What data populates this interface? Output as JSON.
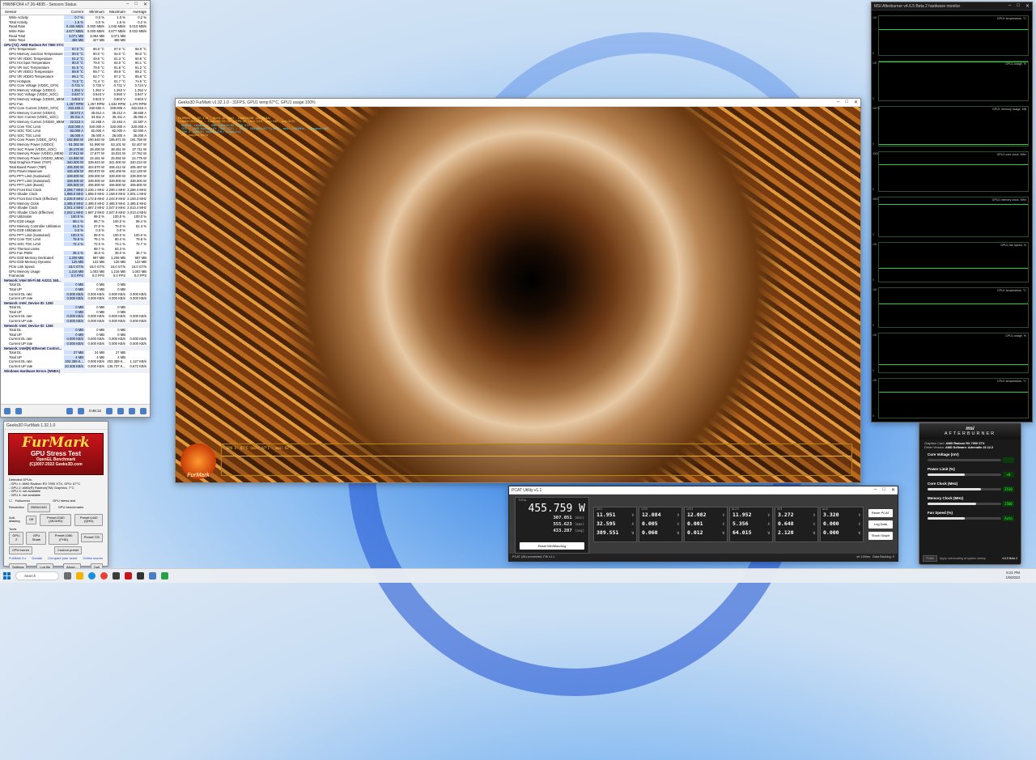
{
  "hwinfo": {
    "title": "HWiNFO64 v7.26-4835 - Sensors Status",
    "columns": [
      "Sensor",
      "Current",
      "Minimum",
      "Maximum",
      "Average"
    ],
    "rows": [
      {
        "n": "Write Activity",
        "v": [
          "0.7 %",
          "0.0 %",
          "1.0 %",
          "0.2 %"
        ]
      },
      {
        "n": "Total Activity",
        "v": [
          "1.5 %",
          "0.0 %",
          "1.6 %",
          "0.2 %"
        ]
      },
      {
        "n": "Read Rate",
        "v": [
          "0.155 MB/s",
          "0.000 MB/s",
          "1.040 MB/s",
          "0.010 MB/s"
        ]
      },
      {
        "n": "Write Rate",
        "v": [
          "4.677 MB/s",
          "0.000 MB/s",
          "4.677 MB/s",
          "0.022 MB/s"
        ]
      },
      {
        "n": "Read Total",
        "v": [
          "3,071 MB",
          "3,064 MB",
          "3,071 MB",
          ""
        ]
      },
      {
        "n": "Write Total",
        "v": [
          "488 MB",
          "427 MB",
          "488 MB",
          ""
        ]
      },
      {
        "n": "GPU [#2]: AMD Radeon RX 7900 XTX:",
        "g": true
      },
      {
        "n": "GPU Temperature",
        "v": [
          "67.0 °C",
          "66.0 °C",
          "67.0 °C",
          "66.9 °C"
        ]
      },
      {
        "n": "GPU Memory Junction Temperature",
        "v": [
          "90.0 °C",
          "90.0 °C",
          "92.0 °C",
          "90.0 °C"
        ]
      },
      {
        "n": "GPU VR VDDC Temperature",
        "v": [
          "51.2 °C",
          "49.6 °C",
          "51.3 °C",
          "50.6 °C"
        ]
      },
      {
        "n": "GPU Hot Spot Temperature",
        "v": [
          "80.0 °C",
          "79.0 °C",
          "82.0 °C",
          "80.1 °C"
        ]
      },
      {
        "n": "GPU VR SoC Temperature",
        "v": [
          "81.5 °C",
          "79.0 °C",
          "81.8 °C",
          "81.2 °C"
        ]
      },
      {
        "n": "GPU VR VDDCI Temperature",
        "v": [
          "89.9 °C",
          "89.7 °C",
          "89.9 °C",
          "89.2 °C"
        ]
      },
      {
        "n": "GPU VR VDDIO Temperature",
        "v": [
          "86.1 °C",
          "82.7 °C",
          "87.2 °C",
          "85.8 °C"
        ]
      },
      {
        "n": "GPU Hotspots",
        "v": [
          "74.0 °C",
          "71.4 °C",
          "81.7 °C",
          "74.6 °C"
        ]
      },
      {
        "n": "GPU Core Voltage (VDDC_GFX)",
        "v": [
          "0.731 V",
          "0.730 V",
          "0.731 V",
          "0.724 V"
        ]
      },
      {
        "n": "GPU Memory Voltage (VDDCI)",
        "v": [
          "1.352 V",
          "1.352 V",
          "1.353 V",
          "1.352 V"
        ]
      },
      {
        "n": "GPU SoC Voltage (VDDC_SOC)",
        "v": [
          "0.947 V",
          "0.943 V",
          "0.950 V",
          "0.947 V"
        ]
      },
      {
        "n": "GPU Memory Voltage (VDDIO_MEM)",
        "v": [
          "0.803 V",
          "0.803 V",
          "0.803 V",
          "0.803 V"
        ]
      },
      {
        "n": "GPU Fan",
        "v": [
          "1,457 RPM",
          "1,457 RPM",
          "1,534 RPM",
          "1,470 RPM"
        ]
      },
      {
        "n": "GPU Core Current (VDDC_GFX)",
        "v": [
          "263.460 A",
          "260.582 A",
          "269.806 A",
          "262.815 A"
        ]
      },
      {
        "n": "GPU Memory Current (VDDCI)",
        "v": [
          "38.574 A",
          "36.912 A",
          "39.212 A",
          "38.566 A"
        ]
      },
      {
        "n": "GPU SoC Current (VDDC_SOC)",
        "v": [
          "35.011 A",
          "34.811 A",
          "35.411 A",
          "35.092 A"
        ]
      },
      {
        "n": "GPU Memory Current (VDDIO_MEM)",
        "v": [
          "22.513 A",
          "22.268 A",
          "22.464 A",
          "22.387 A"
        ]
      },
      {
        "n": "GPU Core TDC Limit",
        "v": [
          "320.000 A",
          "320.000 A",
          "320.000 A",
          "320.000 A"
        ]
      },
      {
        "n": "GPU SOC TDC Limit",
        "v": [
          "82.000 A",
          "82.000 A",
          "82.000 A",
          "82.000 A"
        ]
      },
      {
        "n": "GPU SOC TDC Limit",
        "v": [
          "36.000 A",
          "36.000 A",
          "36.000 A",
          "36.000 A"
        ]
      },
      {
        "n": "GPU Core Power (VDDC_GFX)",
        "v": [
          "192.860 W",
          "190.540 W",
          "196.871 W",
          "191.759 W"
        ]
      },
      {
        "n": "GPU Memory Power (VDDCI)",
        "v": [
          "51.362 W",
          "51.990 W",
          "53.101 W",
          "52.407 W"
        ]
      },
      {
        "n": "GPU SoC Power (VDDC_SOC)",
        "v": [
          "36.478 W",
          "38.490 W",
          "38.451 W",
          "37.711 W"
        ]
      },
      {
        "n": "GPU Memory Power (VDDCI_MEM)",
        "v": [
          "17.912 W",
          "17.677 W",
          "18.022 W",
          "17.762 W"
        ]
      },
      {
        "n": "GPU Memory Power (VDDIO_MEM)",
        "v": [
          "24.990 W",
          "24.461 W",
          "25.092 W",
          "24.779 W"
        ]
      },
      {
        "n": "Total Graphics Power (TGP)",
        "v": [
          "340.000 W",
          "339.923 W",
          "341.000 W",
          "340.224 W"
        ]
      },
      {
        "n": "Total Board Power (TBP)",
        "v": [
          "406.090 W",
          "404.870 W",
          "406.412 W",
          "405.487 W"
        ]
      },
      {
        "n": "GPU Power Maximum",
        "v": [
          "426.408 W",
          "400.870 W",
          "426.408 W",
          "412.128 W"
        ]
      },
      {
        "n": "GPU PPT Limit (Sustained)",
        "v": [
          "339.000 W",
          "339.000 W",
          "339.000 W",
          "339.000 W"
        ]
      },
      {
        "n": "GPU PPT Limit (Sustained)",
        "v": [
          "339.000 W",
          "339.000 W",
          "339.000 W",
          "339.000 W"
        ]
      },
      {
        "n": "GPU PPT Limit (Boost)",
        "v": [
          "406.800 W",
          "406.800 W",
          "406.800 W",
          "406.800 W"
        ]
      },
      {
        "n": "GPU Front End Clock",
        "v": [
          "2,285.7 MHz",
          "2,226.1 MHz",
          "2,290.1 MHz",
          "2,256.4 MHz"
        ]
      },
      {
        "n": "GPU Shader Clock",
        "v": [
          "1,866.0 MHz",
          "1,866.0 MHz",
          "2,158.0 MHz",
          "2,001.1 MHz"
        ]
      },
      {
        "n": "GPU Front End Clock (Effective)",
        "v": [
          "2,226.0 MHz",
          "2,172.8 MHz",
          "2,244.9 MHz",
          "2,193.3 MHz"
        ]
      },
      {
        "n": "GPU Memory Clock",
        "v": [
          "2,485.0 MHz",
          "2,485.0 MHz",
          "2,485.0 MHz",
          "2,485.0 MHz"
        ]
      },
      {
        "n": "GPU Shader Clock",
        "v": [
          "2,041.4 MHz",
          "1,667.3 MHz",
          "2,047.0 MHz",
          "2,013.4 MHz"
        ]
      },
      {
        "n": "GPU Shader Clock (Effective)",
        "v": [
          "2,042.1 MHz",
          "1,667.3 MHz",
          "2,047.0 MHz",
          "2,013.4 MHz"
        ]
      },
      {
        "n": "GPU Utilization",
        "v": [
          "100.0 %",
          "99.0 %",
          "100.0 %",
          "100.0 %"
        ]
      },
      {
        "n": "GPU D3D Usage",
        "v": [
          "99.1 %",
          "98.7 %",
          "100.0 %",
          "99.4 %"
        ]
      },
      {
        "n": "GPU Memory Controller Utilization",
        "v": [
          "61.0 %",
          "27.0 %",
          "79.0 %",
          "61.3 %"
        ]
      },
      {
        "n": "GPU D3D Utilizations",
        "v": [
          "0.0 %",
          "0.0 %",
          "0.0 %",
          ""
        ]
      },
      {
        "n": "GPU PPT Limit (Sustained)",
        "v": [
          "100.0 %",
          "99.0 %",
          "100.0 %",
          "100.0 %"
        ]
      },
      {
        "n": "GPU Core TDC Limit",
        "v": [
          "79.9 %",
          "79.1 %",
          "80.4 %",
          "79.8 %"
        ]
      },
      {
        "n": "GPU SOC TDC Limit",
        "v": [
          "72.4 %",
          "72.0 %",
          "73.1 %",
          "72.7 %"
        ]
      },
      {
        "n": "GPU Thermal Limits",
        "v": [
          "",
          "98.7 %",
          "83.3 %",
          ""
        ]
      },
      {
        "n": "GPU Fan PWM",
        "v": [
          "36.4 %",
          "36.0 %",
          "38.0 %",
          "36.7 %"
        ]
      },
      {
        "n": "GPU D3D Memory Dedicated",
        "v": [
          "1,208 MB",
          "997 MB",
          "1,208 MB",
          "997 MB"
        ]
      },
      {
        "n": "GPU D3D Memory Dynamic",
        "v": [
          "125 MB",
          "122 MB",
          "125 MB",
          "122 MB"
        ]
      },
      {
        "n": "PCIe Link Speed",
        "v": [
          "16.0 GT/s",
          "16.0 GT/s",
          "16.0 GT/s",
          "16.0 GT/s"
        ]
      },
      {
        "n": "GPU Memory Usage",
        "v": [
          "1,216 MB",
          "1,003 MB",
          "1,216 MB",
          "1,003 MB"
        ]
      },
      {
        "n": "Framerate",
        "v": [
          "0.0 FPS",
          "0.0 FPS",
          "0.0 FPS",
          "0.0 FPS"
        ]
      },
      {
        "n": "Network: Intel Wi-Fi 6E AX211 160...",
        "g": true
      },
      {
        "n": "Total DL",
        "v": [
          "0 MB",
          "0 MB",
          "0 MB",
          ""
        ]
      },
      {
        "n": "Total UP",
        "v": [
          "0 MB",
          "0 MB",
          "0 MB",
          ""
        ]
      },
      {
        "n": "Current DL rate",
        "v": [
          "0.000 KB/s",
          "0.000 KB/s",
          "0.000 KB/s",
          "0.000 KB/s"
        ]
      },
      {
        "n": "Current UP rate",
        "v": [
          "0.000 KB/s",
          "0.000 KB/s",
          "0.000 KB/s",
          "0.000 KB/s"
        ]
      },
      {
        "n": "Network: Intel_Device ID: 1250",
        "g": true
      },
      {
        "n": "Total DL",
        "v": [
          "0 MB",
          "0 MB",
          "0 MB",
          ""
        ]
      },
      {
        "n": "Total UP",
        "v": [
          "0 MB",
          "0 MB",
          "0 MB",
          ""
        ]
      },
      {
        "n": "Current DL rate",
        "v": [
          "0.000 KB/s",
          "0.000 KB/s",
          "0.000 KB/s",
          "0.000 KB/s"
        ]
      },
      {
        "n": "Current UP rate",
        "v": [
          "0.000 KB/s",
          "0.000 KB/s",
          "0.000 KB/s",
          "0.000 KB/s"
        ]
      },
      {
        "n": "Network: Intel_Device ID: 1250",
        "g": true
      },
      {
        "n": "Total DL",
        "v": [
          "0 MB",
          "0 MB",
          "0 MB",
          ""
        ]
      },
      {
        "n": "Total UP",
        "v": [
          "0 MB",
          "0 MB",
          "0 MB",
          ""
        ]
      },
      {
        "n": "Current DL rate",
        "v": [
          "0.000 KB/s",
          "0.000 KB/s",
          "0.000 KB/s",
          "0.000 KB/s"
        ]
      },
      {
        "n": "Current UP rate",
        "v": [
          "0.000 KB/s",
          "0.000 KB/s",
          "0.000 KB/s",
          "0.000 KB/s"
        ]
      },
      {
        "n": "Network: Intel(R) Ethernet Control...",
        "g": true
      },
      {
        "n": "Total DL",
        "v": [
          "27 MB",
          "24 MB",
          "27 MB",
          ""
        ]
      },
      {
        "n": "Total UP",
        "v": [
          "4 MB",
          "4 MB",
          "4 MB",
          ""
        ]
      },
      {
        "n": "Current DL rate",
        "v": [
          "202.359 K...",
          "0.000 KB/s",
          "202.359 K...",
          "1.127 KB/s"
        ]
      },
      {
        "n": "Current UP rate",
        "v": [
          "20.305 KB/s",
          "0.000 KB/s",
          "136.737 K...",
          "0.672 KB/s"
        ]
      },
      {
        "n": "Windows Hardware Errors (WHEA)",
        "g": true
      }
    ],
    "footer_time": "0:46:12"
  },
  "furmark_small": {
    "title": "Geeks3D FurMark 1.32.1.0",
    "logo1": "FurMark",
    "logo2": "GPU Stress Test",
    "logo3": "OpenGL Benchmark",
    "logo4": "(C)2007-2022 Geeks3D.com",
    "detected": [
      "Detected GPUs:",
      "- GPU 1: AMD Radeon RX 7900 XTX, GPU: 67°C",
      "- GPU 2: AMD(R) Radeon(TM) Graphics, 7°C",
      "- GPU 3: not available",
      "- GPU 4: not available"
    ],
    "fullscreen": "Fullscreen",
    "resolution_label": "Resolution",
    "resolution": "2560x1440",
    "antialias_label": "Anti-aliasing",
    "antialias": "Off",
    "tools": "Tools",
    "gpu_shark": "GPU-Z",
    "gpu_shark2": "GPU Shark",
    "cpu_burner": "CPU burner",
    "presets": [
      "Preset:2160 (4K/UHD)",
      "Preset:1440 (QHD)",
      "Preset:1080 (FHD)",
      "Preset:720"
    ],
    "gpu_stress": "GPU stress test",
    "gpu_bench": "GPU benchmarks",
    "custom": "Custom preset",
    "links": [
      "FurMark 2.x",
      "Donate",
      "Compare your score",
      "Online scores"
    ],
    "buttons": [
      "Settings",
      "Log file",
      "About...",
      "Quit"
    ]
  },
  "render": {
    "title": "Geeks3D FurMark v1.32.1.0 - 31FPS, GPU1 temp:67°C, GPU1 usage:100%",
    "hud": [
      "FurMark v1.32.1.0 - Burn-in test, 2560x1440 (0X MSAA)",
      "Frames:1659808 - time:00:53:50 - FPS:32 (min:225, max:340, avg:315)"
    ],
    "hud2": [
      "- OpenGL renderer: AMD Radeon RX 7900 XTX",
      "- GPU 1 (AMD Radeon RX 7900 XTX) - core: 2041MHz/67°C/100%, mem: 2485MHz, fanspeed:36%",
      "- GPU 2 (AMD(R) Radeon(TM) Graphics)",
      "- F1: toggle help"
    ],
    "graph_label": "GPU 1: 67°C (min: 67°C - max: 67°C)",
    "badge": "FurMark"
  },
  "monitor": {
    "title": "MSI Afterburner v4.6.5 Beta 2 hardware monitor",
    "graphs": [
      {
        "label": "GPU1 temperature, °C",
        "max": "100",
        "min": "0"
      },
      {
        "label": "GPU1 usage, %",
        "max": "100",
        "min": "0"
      },
      {
        "label": "GPU1 memory usage, MB",
        "max": "24576",
        "min": "0"
      },
      {
        "label": "GPU1 core clock, MHz",
        "max": "3000",
        "min": "0"
      },
      {
        "label": "GPU1 memory clock, MHz",
        "max": "3000",
        "min": "0"
      },
      {
        "label": "GPU1 fan speed, %",
        "max": "100",
        "min": "0"
      },
      {
        "label": "CPU1 temperature, °C",
        "max": "100",
        "min": "0"
      },
      {
        "label": "CPU1 usage, %",
        "max": "100",
        "min": "0"
      },
      {
        "label": "CPU1 temperature, °C",
        "max": "100",
        "min": "0"
      }
    ]
  },
  "afterburner": {
    "brand": "msi",
    "name": "AFTERBURNER",
    "gpu_label": "Graphics Card",
    "gpu": "AMD Radeon RX 7900 XTX",
    "driver_label": "Driver Version",
    "driver": "AMD Software: Adrenalin 22.12.2",
    "sliders": [
      {
        "name": "Core Voltage (mV)",
        "val": "",
        "fill": 0.0
      },
      {
        "name": "Power Limit (%)",
        "val": "+0",
        "fill": 0.5
      },
      {
        "name": "Core Clock (MHz)",
        "val": "2510",
        "fill": 0.72
      },
      {
        "name": "Memory Clock (MHz)",
        "val": "2500",
        "fill": 0.66
      },
      {
        "name": "Fan Speed (%)",
        "val": "Auto",
        "fill": 0.5
      }
    ],
    "footer": [
      "Profile",
      "Apply overclocking at system startup",
      "4.6.5 Beta 2"
    ]
  },
  "pcat": {
    "title": "PCAT Utility v1.1",
    "total_label": "TOTAL",
    "total": "455.759 W",
    "min": "307.051",
    "avg": "433.287",
    "max": "555.623",
    "min_l": "(min)",
    "max_l": "(max)",
    "avg_l": "(avg)",
    "reset": "Reset Min/Max/Avg",
    "rails": [
      {
        "label": "12V1",
        "v": "11.951",
        "a": "32.595",
        "w": "389.551"
      },
      {
        "label": "12V2",
        "v": "12.084",
        "a": "0.005",
        "w": "0.060"
      },
      {
        "label": "12V3",
        "v": "12.082",
        "a": "0.001",
        "w": "0.012"
      },
      {
        "label": "SLOT",
        "v": "11.952",
        "a": "5.356",
        "w": "64.015"
      },
      {
        "label": "3V3",
        "v": "3.272",
        "a": "0.648",
        "w": "2.120"
      },
      {
        "label": "AUX",
        "v": "3.320",
        "a": "0.000",
        "w": "0.000"
      }
    ],
    "units": [
      "V",
      "A",
      "W"
    ],
    "buttons": [
      "Reset PCAT",
      "Log Data",
      "Show Graph"
    ],
    "status": "PCAT (28) connected, FW v1.1",
    "status2": "dt: 100ms",
    "status3": "Data Backlog: 0"
  },
  "taskbar": {
    "search": "Search",
    "time": "6:21 PM",
    "date": "1/9/2023"
  },
  "colors": {
    "accent": "#0078d4",
    "green": "#28d428",
    "fur": "#c8141a"
  }
}
